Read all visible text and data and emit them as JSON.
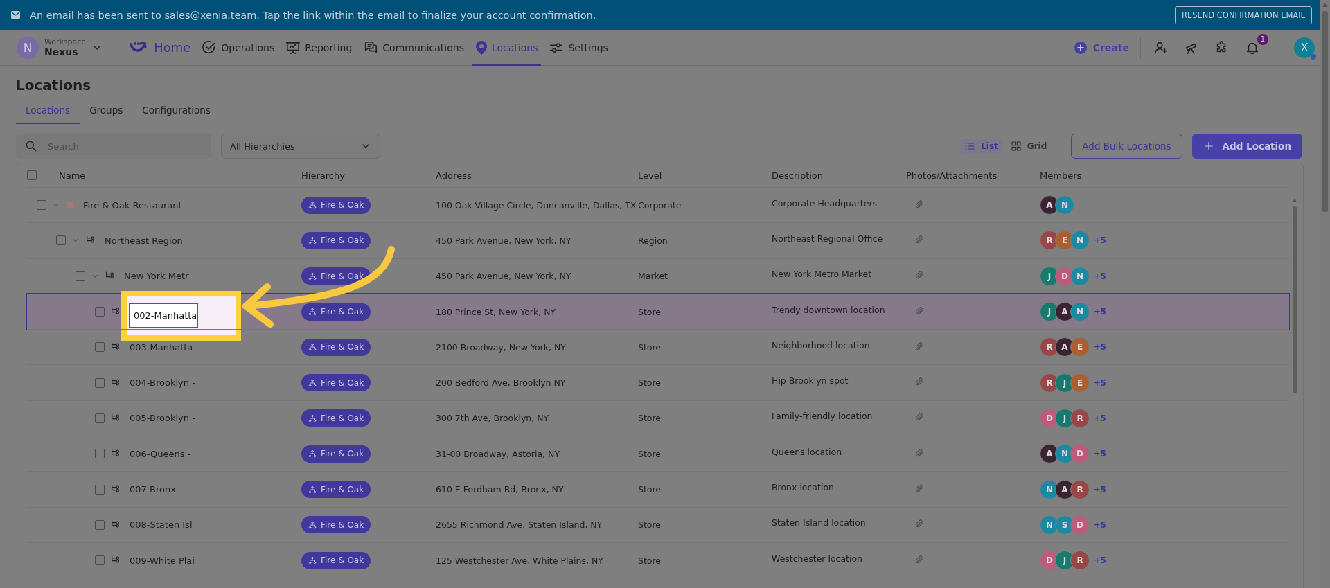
{
  "banner": {
    "message": "An email has been sent to sales@xenia.team. Tap the link within the email to finalize your account confirmation.",
    "button": "RESEND CONFIRMATION EMAIL"
  },
  "nav": {
    "workspace_initial": "N",
    "workspace_label": "Workspace",
    "workspace_name": "Nexus",
    "items": [
      {
        "label": "Home",
        "selected": false
      },
      {
        "label": "Operations",
        "selected": false
      },
      {
        "label": "Reporting",
        "selected": false
      },
      {
        "label": "Communications",
        "selected": false
      },
      {
        "label": "Locations",
        "selected": true
      },
      {
        "label": "Settings",
        "selected": false
      }
    ],
    "create": "Create",
    "notification_count": "1",
    "avatar": "X"
  },
  "page": {
    "title": "Locations",
    "tabs": [
      {
        "label": "Locations",
        "selected": true
      },
      {
        "label": "Groups",
        "selected": false
      },
      {
        "label": "Configurations",
        "selected": false
      }
    ]
  },
  "toolbar": {
    "search_placeholder": "Search",
    "hierarchy_filter": "All Hierarchies",
    "views": [
      {
        "label": "List",
        "selected": true
      },
      {
        "label": "Grid",
        "selected": false
      }
    ],
    "buttons": [
      "Add Bulk Locations",
      "Add Location"
    ]
  },
  "table": {
    "select_all_checked": false,
    "columns": [
      "Name",
      "Hierarchy",
      "Address",
      "Level",
      "Description",
      "Photos/Attachments",
      "Members"
    ],
    "rows": [
      {
        "name": "Fire & Oak Restaurant",
        "checked": false,
        "selected": false,
        "expanded": true,
        "hierarchy": "Fire & Oak",
        "address": "100 Oak Village Circle, Duncanville, Dallas, TX",
        "level": "Corporate",
        "description": "Corporate Headquarters",
        "members": [
          {
            "initial": "A",
            "color": "#3a2434"
          },
          {
            "initial": "N",
            "color": "#1a8aa2"
          }
        ],
        "children": [
          {
            "name": "Northeast Region",
            "checked": false,
            "selected": false,
            "expanded": true,
            "hierarchy": "Fire & Oak",
            "address": "450 Park Avenue, New York, NY",
            "level": "Region",
            "description": "Northeast Regional Office",
            "members": [
              {
                "initial": "R",
                "color": "#984646"
              },
              {
                "initial": "E",
                "color": "#ac5e30"
              },
              {
                "initial": "N",
                "color": "#1a8aa2"
              }
            ],
            "extra": "+5",
            "children": [
              {
                "name": "New York Metr",
                "checked": false,
                "selected": false,
                "expanded": true,
                "hierarchy": "Fire & Oak",
                "address": "450 Park Avenue, New York, NY",
                "level": "Market",
                "description": "New York Metro Market",
                "members": [
                  {
                    "initial": "J",
                    "color": "#167a70"
                  },
                  {
                    "initial": "D",
                    "color": "#c05a7c"
                  },
                  {
                    "initial": "N",
                    "color": "#1a8aa2"
                  }
                ],
                "extra": "+5",
                "children": [
                  {
                    "name": "002-Manhatta",
                    "checked": false,
                    "selected": true,
                    "hierarchy": "Fire & Oak",
                    "address": "180 Prince St, New York, NY",
                    "level": "Store",
                    "description": "Trendy downtown location",
                    "members": [
                      {
                        "initial": "J",
                        "color": "#167a70"
                      },
                      {
                        "initial": "A",
                        "color": "#3a2434"
                      },
                      {
                        "initial": "N",
                        "color": "#1a8aa2"
                      }
                    ],
                    "extra": "+5"
                  },
                  {
                    "name": "003-Manhatta",
                    "checked": false,
                    "selected": false,
                    "hierarchy": "Fire & Oak",
                    "address": "2100 Broadway, New York, NY",
                    "level": "Store",
                    "description": "Neighborhood location",
                    "members": [
                      {
                        "initial": "R",
                        "color": "#984646"
                      },
                      {
                        "initial": "A",
                        "color": "#3a2434"
                      },
                      {
                        "initial": "E",
                        "color": "#ac5e30"
                      }
                    ],
                    "extra": "+5"
                  },
                  {
                    "name": "004-Brooklyn -",
                    "checked": false,
                    "selected": false,
                    "hierarchy": "Fire & Oak",
                    "address": "200 Bedford Ave, Brooklyn NY",
                    "level": "Store",
                    "description": "Hip Brooklyn spot",
                    "members": [
                      {
                        "initial": "R",
                        "color": "#984646"
                      },
                      {
                        "initial": "J",
                        "color": "#167a70"
                      },
                      {
                        "initial": "E",
                        "color": "#ac5e30"
                      }
                    ],
                    "extra": "+5"
                  },
                  {
                    "name": "005-Brooklyn -",
                    "checked": false,
                    "selected": false,
                    "hierarchy": "Fire & Oak",
                    "address": "300 7th Ave, Brooklyn, NY",
                    "level": "Store",
                    "description": "Family-friendly location",
                    "members": [
                      {
                        "initial": "D",
                        "color": "#c05a7c"
                      },
                      {
                        "initial": "J",
                        "color": "#167a70"
                      },
                      {
                        "initial": "R",
                        "color": "#984646"
                      }
                    ],
                    "extra": "+5"
                  },
                  {
                    "name": "006-Queens -",
                    "checked": false,
                    "selected": false,
                    "hierarchy": "Fire & Oak",
                    "address": "31-00 Broadway, Astoria, NY",
                    "level": "Store",
                    "description": "Queens location",
                    "members": [
                      {
                        "initial": "A",
                        "color": "#3a2434"
                      },
                      {
                        "initial": "N",
                        "color": "#1a8aa2"
                      },
                      {
                        "initial": "D",
                        "color": "#c05a7c"
                      }
                    ],
                    "extra": "+5"
                  },
                  {
                    "name": "007-Bronx",
                    "checked": false,
                    "selected": false,
                    "hierarchy": "Fire & Oak",
                    "address": "610 E Fordham Rd, Bronx, NY",
                    "level": "Store",
                    "description": "Bronx location",
                    "members": [
                      {
                        "initial": "N",
                        "color": "#1a8aa2"
                      },
                      {
                        "initial": "A",
                        "color": "#3a2434"
                      },
                      {
                        "initial": "R",
                        "color": "#984646"
                      }
                    ],
                    "extra": "+5"
                  },
                  {
                    "name": "008-Staten Isl",
                    "checked": false,
                    "selected": false,
                    "hierarchy": "Fire & Oak",
                    "address": "2655 Richmond Ave, Staten Island, NY",
                    "level": "Store",
                    "description": "Staten Island location",
                    "members": [
                      {
                        "initial": "N",
                        "color": "#1a8aa2"
                      },
                      {
                        "initial": "S",
                        "color": "#1a8aa2"
                      },
                      {
                        "initial": "D",
                        "color": "#c05a7c"
                      }
                    ],
                    "extra": "+5"
                  },
                  {
                    "name": "009-White Plai",
                    "checked": false,
                    "selected": false,
                    "hierarchy": "Fire & Oak",
                    "address": "125 Westchester Ave, White Plains, NY",
                    "level": "Store",
                    "description": "Westchester location",
                    "members": [
                      {
                        "initial": "D",
                        "color": "#c05a7c"
                      },
                      {
                        "initial": "J",
                        "color": "#167a70"
                      },
                      {
                        "initial": "R",
                        "color": "#984646"
                      }
                    ],
                    "extra": "+5"
                  }
                ]
              }
            ]
          }
        ]
      }
    ]
  }
}
